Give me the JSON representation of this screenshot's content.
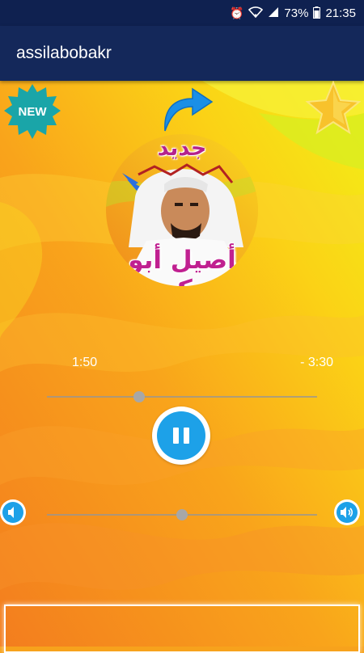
{
  "status_bar": {
    "battery_percent": "73%",
    "time": "21:35",
    "icons": [
      "alarm-icon",
      "wifi-icon",
      "signal-icon",
      "battery-icon"
    ]
  },
  "app_bar": {
    "title": "assilabobakr"
  },
  "badges": {
    "new_label": "NEW"
  },
  "cover": {
    "new_text": "جديد",
    "artist_text": "أصيل أبو بكر"
  },
  "player": {
    "elapsed": "1:50",
    "remaining": "- 3:30",
    "seek_progress": 0.34,
    "volume_level": 0.5,
    "state": "playing"
  },
  "colors": {
    "app_bar": "#14285a",
    "accent": "#1da1e8",
    "artist_text": "#c02090"
  }
}
